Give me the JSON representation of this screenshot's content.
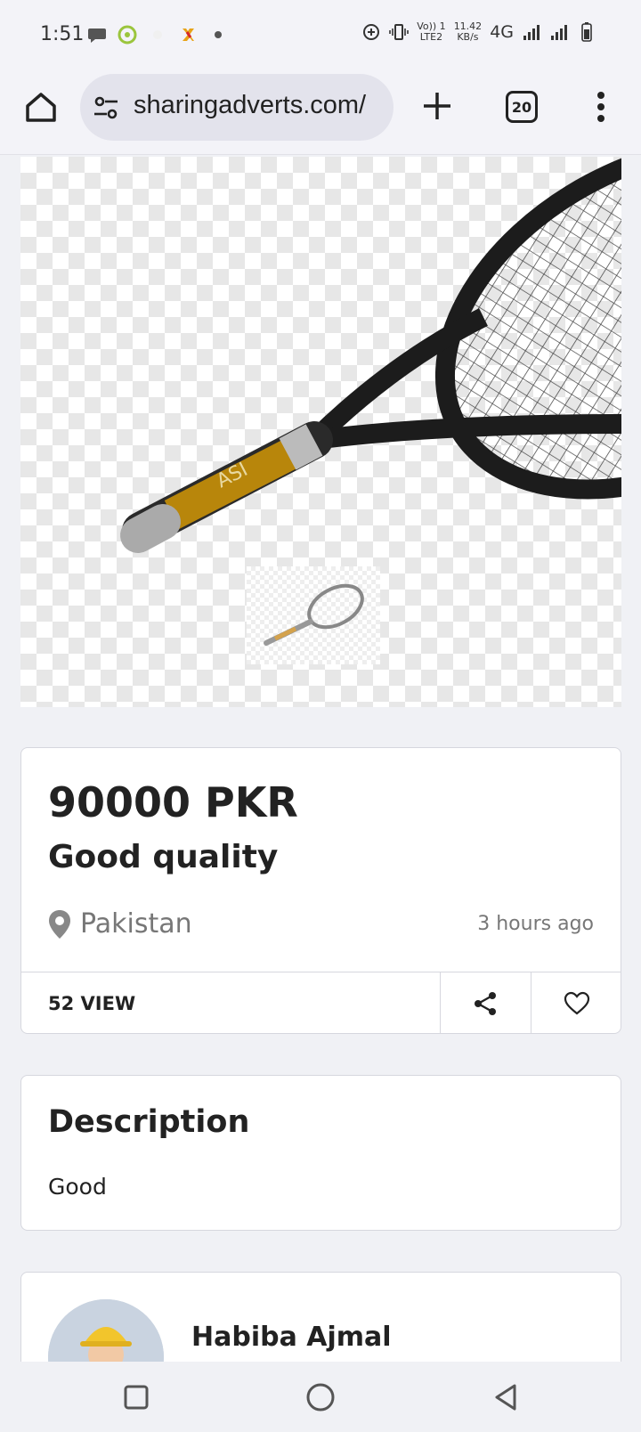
{
  "status_bar": {
    "time": "1:51",
    "volte_line1": "Vo)) 1",
    "volte_line2": "LTE2",
    "speed_line1": "11.42",
    "speed_line2": "KB/s",
    "network": "4G"
  },
  "browser": {
    "url": "sharingadverts.com/",
    "tab_count": "20"
  },
  "listing": {
    "price": "90000 PKR",
    "title": "Good quality",
    "location": "Pakistan",
    "time_ago": "3 hours ago",
    "views": "52 VIEW"
  },
  "description": {
    "heading": "Description",
    "text": "Good"
  },
  "seller": {
    "name": "Habiba Ajmal"
  },
  "icons": {
    "home": "home-icon",
    "site_settings": "tune-icon",
    "new_tab": "plus-icon",
    "tabs": "tab-switcher-icon",
    "menu": "more-vert-icon",
    "location": "location-pin-icon",
    "share": "share-icon",
    "favorite": "heart-icon"
  }
}
